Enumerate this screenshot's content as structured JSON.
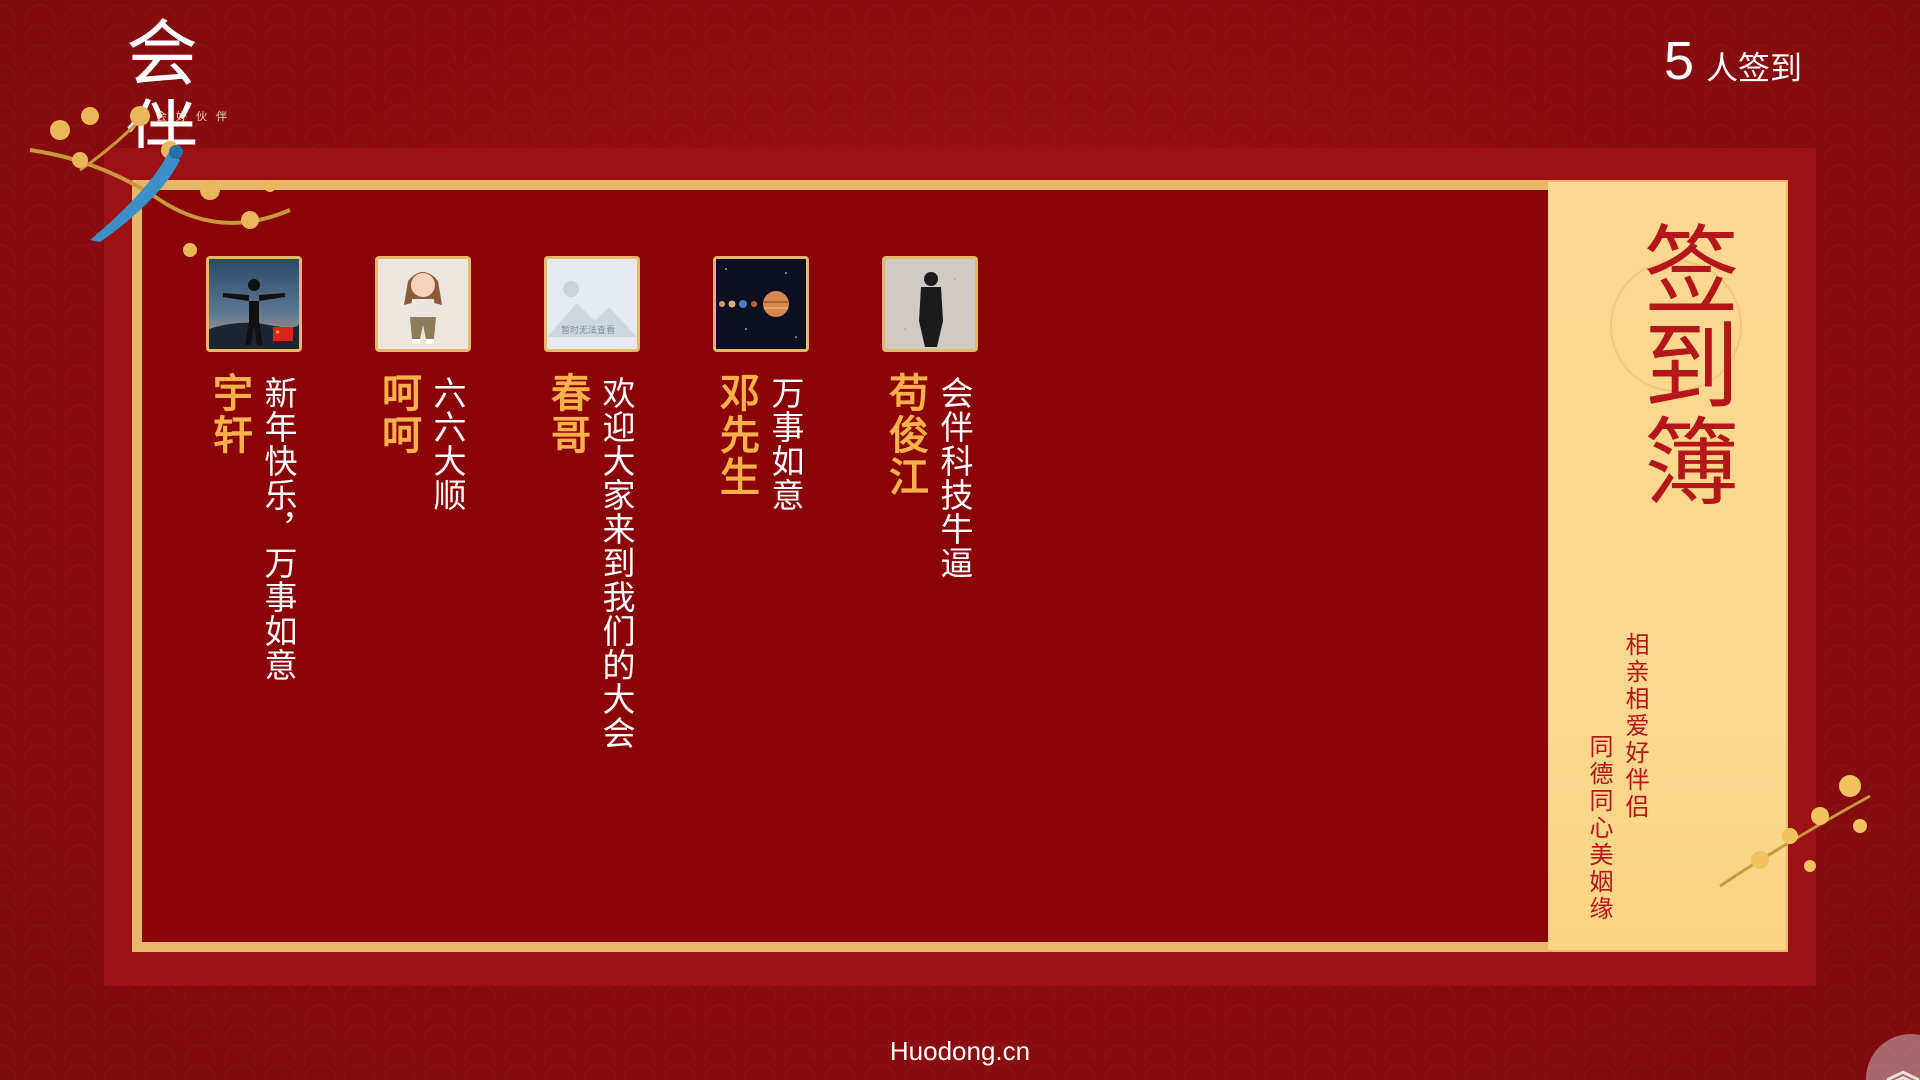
{
  "logo": {
    "mark": "会伴",
    "tagline": "办会好伙伴"
  },
  "header": {
    "count": "5",
    "count_label": "人签到"
  },
  "panel": {
    "title": "签到簿",
    "couplet_1": "相亲相爱好伴侣",
    "couplet_2": "同德同心美姻缘"
  },
  "entries": [
    {
      "name": "宇轩",
      "message": "新年快乐，万事如意",
      "avatar": "man-silhouette-sky-photo"
    },
    {
      "name": "呵呵",
      "message": "六六大顺",
      "avatar": "cartoon-girl-figure"
    },
    {
      "name": "春哥",
      "message": "欢迎大家来到我们的大会",
      "avatar": "image-placeholder",
      "avatar_caption": "暂时无法查看"
    },
    {
      "name": "邓先生",
      "message": "万事如意",
      "avatar": "solar-system-planets"
    },
    {
      "name": "苟俊江",
      "message": "会伴科技牛逼",
      "avatar": "shadow-on-ground"
    }
  ],
  "footer": {
    "brand": "Huodong.cn"
  },
  "colors": {
    "background": "#8f0d0f",
    "gold": "#e8b76a",
    "cream": "#fbd78f",
    "title_red": "#b4161a",
    "name_orange": "#f7b04a"
  }
}
